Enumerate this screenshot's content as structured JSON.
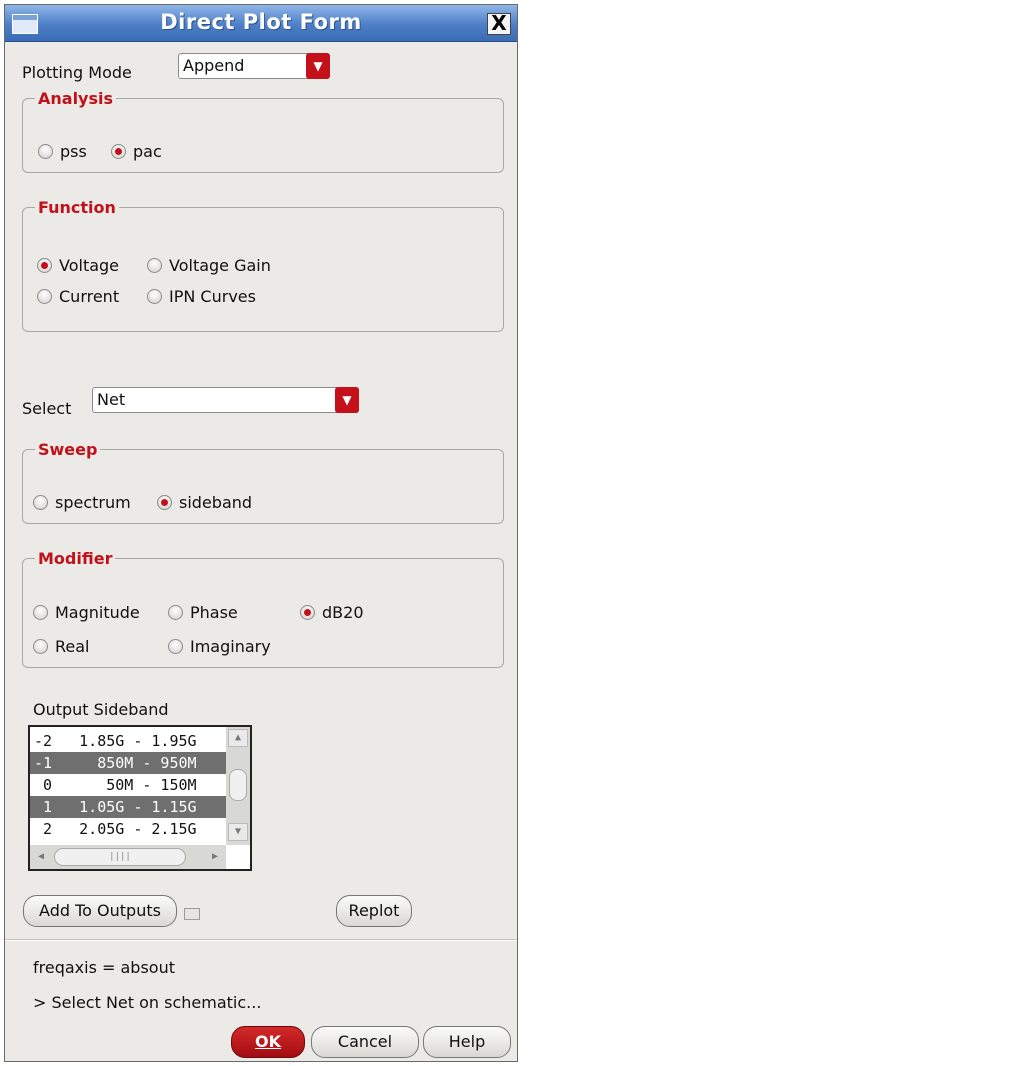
{
  "window": {
    "title": "Direct Plot Form",
    "close_label": "X"
  },
  "plotting_mode": {
    "label": "Plotting Mode",
    "value": "Append"
  },
  "analysis": {
    "title": "Analysis",
    "options": [
      "pss",
      "pac"
    ],
    "selected": "pac"
  },
  "function": {
    "title": "Function",
    "options": [
      "Voltage",
      "Voltage Gain",
      "Current",
      "IPN Curves"
    ],
    "selected": "Voltage"
  },
  "select": {
    "label": "Select",
    "value": "Net"
  },
  "sweep": {
    "title": "Sweep",
    "options": [
      "spectrum",
      "sideband"
    ],
    "selected": "sideband"
  },
  "modifier": {
    "title": "Modifier",
    "options": [
      "Magnitude",
      "Phase",
      "dB20",
      "Real",
      "Imaginary"
    ],
    "selected": "dB20"
  },
  "output_sideband": {
    "label": "Output Sideband",
    "rows": [
      {
        "index": "-2",
        "range": "1.85G - 1.95G"
      },
      {
        "index": "-1",
        "range": "850M - 950M"
      },
      {
        "index": "0",
        "range": "50M - 150M"
      },
      {
        "index": "1",
        "range": "1.05G - 1.15G"
      },
      {
        "index": "2",
        "range": "2.05G - 2.15G"
      }
    ],
    "selected_rows": [
      "-1",
      "1"
    ]
  },
  "buttons": {
    "add_to_outputs": "Add To Outputs",
    "replot": "Replot",
    "ok": "OK",
    "cancel": "Cancel",
    "help": "Help"
  },
  "status": {
    "freqaxis": "freqaxis = absout",
    "prompt": "> Select Net on schematic..."
  },
  "colors": {
    "accent": "#c0121b",
    "titlebar": "#4d7fc7",
    "background": "#eceae6",
    "selected_row": "#6f6f6f"
  }
}
